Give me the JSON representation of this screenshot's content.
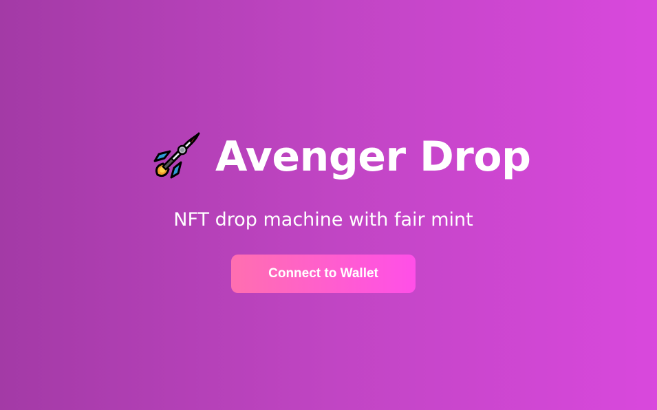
{
  "hero": {
    "title": "Avenger Drop",
    "title_icon": "rocket-icon",
    "subtitle": "NFT drop machine with fair mint",
    "connect_button_label": "Connect to Wallet"
  },
  "colors": {
    "background_start": "#a33aa6",
    "background_end": "#d948dd",
    "button_start": "#ff6fb0",
    "button_end": "#ff4fe8",
    "text": "#ffffff"
  }
}
